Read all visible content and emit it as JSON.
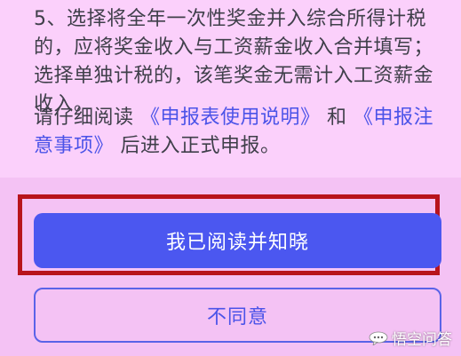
{
  "notice": {
    "item5": "5、选择将全年一次性奖金并入综合所得计税的，应将奖金收入与工资薪金收入合并填写；选择单独计税的，该笔奖金无需计入工资薪金收入。",
    "read_prefix": "请仔细阅读 ",
    "link_instructions": "《申报表使用说明》",
    "read_and": " 和 ",
    "link_notes": "《申报注意事项》",
    "read_suffix": " 后进入正式申报。"
  },
  "actions": {
    "confirm_label": "我已阅读并知晓",
    "reject_label": "不同意"
  },
  "watermark": {
    "text": "悟空问答",
    "icon": "chat-bubble-icon"
  },
  "colors": {
    "accent": "#4b57f0",
    "link": "#4b53e8",
    "highlight_border": "#b8141c",
    "background": "#fbd0fb"
  }
}
